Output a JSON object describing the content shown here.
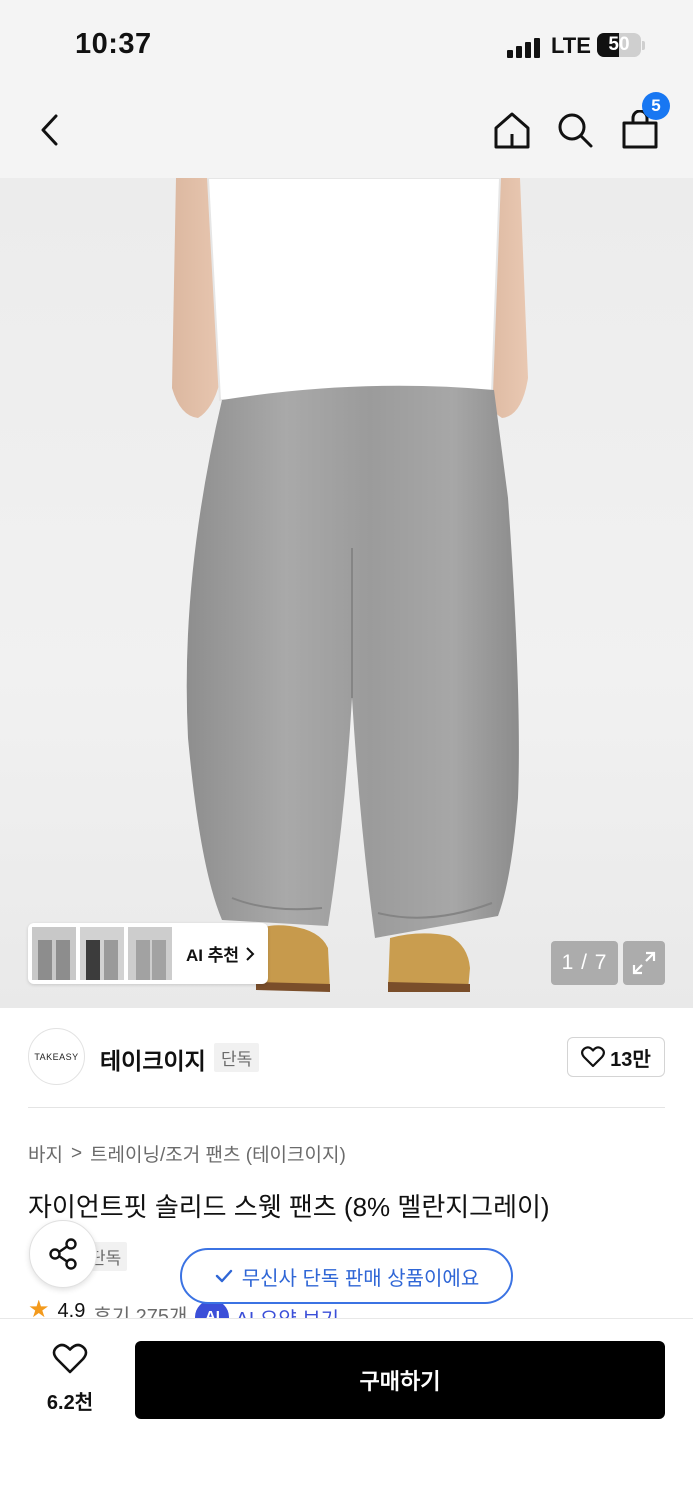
{
  "status_bar": {
    "time": "10:37",
    "network": "LTE",
    "battery": "50",
    "battery_level_percent": 50
  },
  "nav": {
    "back_icon": "chevron-left-icon",
    "home_icon": "home-icon",
    "search_icon": "search-icon",
    "cart_icon": "shopping-bag-icon",
    "cart_badge": "5",
    "badge_color": "#1877f2"
  },
  "gallery": {
    "ai_recommend_label": "AI 추천",
    "counter": "1 / 7",
    "expand_icon": "expand-icon"
  },
  "brand": {
    "logo_text": "TAKEASY",
    "name": "테이크이지",
    "tag": "단독",
    "likes": "13만"
  },
  "breadcrumb": {
    "category": "바지",
    "separator": ">",
    "subcategory": "트레이닝/조거 팬츠 (테이크이지)"
  },
  "product": {
    "title": "자이언트핏 솔리드 스웻 팬츠 (8% 멜란지그레이)",
    "exclusive_tag": "단독",
    "exclusive_notice": "무신사 단독 판매 상품이에요",
    "rating": "4.9",
    "reviews": "후기 275개",
    "ai_chip": "AI",
    "ai_summary": "AI 요약 보기"
  },
  "bottom_bar": {
    "wish_count": "6.2천",
    "buy_label": "구매하기"
  },
  "colors": {
    "accent_blue": "#3b73e3",
    "rating_star": "#f39a1c",
    "buy_button": "#000000"
  }
}
